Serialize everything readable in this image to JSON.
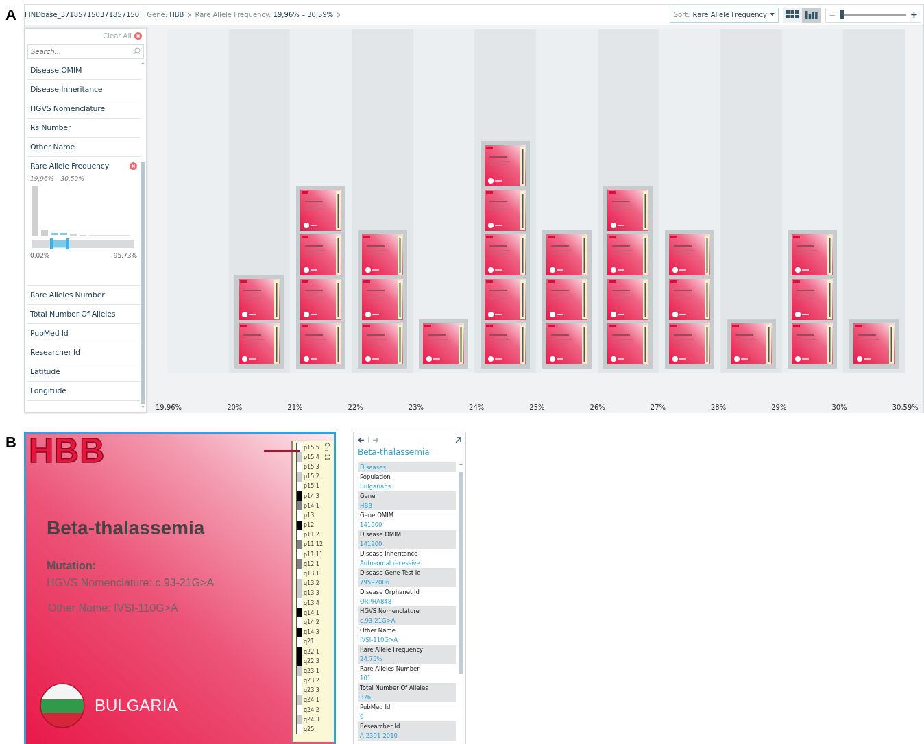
{
  "panel_labels": [
    "A",
    "B"
  ],
  "toolbar": {
    "collection": "FINDbase_371857150371857150",
    "breadcrumbs": [
      {
        "label": "Gene:",
        "value": "HBB"
      },
      {
        "label": "Rare Allele Frequency:",
        "value": "19,96% – 30,59%"
      }
    ],
    "sort": {
      "label": "Sort:",
      "value": "Rare Allele Frequency"
    },
    "views": [
      {
        "kind": "grid",
        "selected": false
      },
      {
        "kind": "bars",
        "selected": true
      }
    ],
    "zoom": {
      "minus": "−",
      "plus": "+",
      "level": 0.03
    }
  },
  "sidebar": {
    "clear_all": "Clear All",
    "search": {
      "placeholder": "Search..."
    },
    "facets": [
      {
        "label": "Disease OMIM",
        "expanded": false,
        "filtered": false
      },
      {
        "label": "Disease Inheritance",
        "expanded": false,
        "filtered": false
      },
      {
        "label": "HGVS Nomenclature",
        "expanded": false,
        "filtered": false
      },
      {
        "label": "Rs Number",
        "expanded": false,
        "filtered": false
      },
      {
        "label": "Other Name",
        "expanded": false,
        "filtered": false
      },
      {
        "label": "Rare Allele Frequency",
        "expanded": true,
        "filtered": true,
        "range": "19,96% – 30,59%",
        "min": "0,02%",
        "max": "95,73%"
      },
      {
        "label": "Rare Alleles Number",
        "expanded": false,
        "filtered": false
      },
      {
        "label": "Total Number Of Alleles",
        "expanded": false,
        "filtered": false
      },
      {
        "label": "PubMed Id",
        "expanded": false,
        "filtered": false
      },
      {
        "label": "Researcher Id",
        "expanded": false,
        "filtered": false
      },
      {
        "label": "Latitude",
        "expanded": false,
        "filtered": false
      },
      {
        "label": "Longitude",
        "expanded": false,
        "filtered": false
      }
    ]
  },
  "bins": [
    {
      "kind": "empty"
    },
    {
      "kind": "stack",
      "cards": [
        {
          "kind": "thumbnail"
        },
        {
          "kind": "thumbnail"
        }
      ]
    },
    {
      "kind": "stack",
      "cards": [
        {
          "kind": "thumbnail"
        },
        {
          "kind": "thumbnail"
        },
        {
          "kind": "thumbnail"
        },
        {
          "kind": "thumbnail"
        }
      ]
    },
    {
      "kind": "stack",
      "cards": [
        {
          "kind": "thumbnail"
        },
        {
          "kind": "thumbnail"
        },
        {
          "kind": "thumbnail"
        }
      ]
    },
    {
      "kind": "stack",
      "cards": [
        {
          "kind": "thumbnail"
        }
      ]
    },
    {
      "kind": "stack",
      "cards": [
        {
          "kind": "thumbnail"
        },
        {
          "kind": "thumbnail"
        },
        {
          "kind": "thumbnail"
        },
        {
          "kind": "thumbnail"
        },
        {
          "kind": "thumbnail"
        }
      ]
    },
    {
      "kind": "stack",
      "cards": [
        {
          "kind": "thumbnail"
        },
        {
          "kind": "thumbnail"
        },
        {
          "kind": "thumbnail"
        }
      ]
    },
    {
      "kind": "stack",
      "cards": [
        {
          "kind": "thumbnail"
        },
        {
          "kind": "thumbnail"
        },
        {
          "kind": "thumbnail"
        },
        {
          "kind": "thumbnail"
        }
      ]
    },
    {
      "kind": "stack",
      "cards": [
        {
          "kind": "thumbnail"
        },
        {
          "kind": "thumbnail"
        },
        {
          "kind": "thumbnail"
        }
      ]
    },
    {
      "kind": "stack",
      "cards": [
        {
          "kind": "thumbnail"
        }
      ]
    },
    {
      "kind": "stack",
      "cards": [
        {
          "kind": "thumbnail"
        },
        {
          "kind": "thumbnail"
        },
        {
          "kind": "thumbnail"
        }
      ]
    },
    {
      "kind": "stack",
      "cards": [
        {
          "kind": "thumbnail"
        }
      ]
    }
  ],
  "axis_labels": [
    "19,96%",
    "20%",
    "21%",
    "22%",
    "23%",
    "24%",
    "25%",
    "26%",
    "27%",
    "28%",
    "29%",
    "30%",
    "30,59%"
  ],
  "card": {
    "gene": "HBB",
    "title": "Beta-thalassemia",
    "mutation": "Mutation:",
    "hgvs": "HGVS Nomenclature: c.93-21G>A",
    "other_name": "Other Name: IVSI-110G>A",
    "country": "BULGARIA",
    "chromosome": "Chr 11",
    "bands": [
      {
        "label": "p15.5",
        "color": "#ffffff"
      },
      {
        "label": "p15.4",
        "color": "#c8c8c8"
      },
      {
        "label": "p15.3",
        "color": "#ffffff"
      },
      {
        "label": "p15.2",
        "color": "#c8c8c8"
      },
      {
        "label": "p15.1",
        "color": "#ffffff"
      },
      {
        "label": "p14.3",
        "color": "#000000"
      },
      {
        "label": "p14.1",
        "color": "#808080"
      },
      {
        "label": "p13",
        "color": "#ffffff"
      },
      {
        "label": "p12",
        "color": "#000000"
      },
      {
        "label": "p11.2",
        "color": "#ffffff"
      },
      {
        "label": "p11.12",
        "color": "#808080"
      },
      {
        "label": "p11.11",
        "color": "#ffffff"
      },
      {
        "label": "q12.1",
        "color": "#808080"
      },
      {
        "label": "q13.1",
        "color": "#ffffff"
      },
      {
        "label": "q13.2",
        "color": "#c8c8c8"
      },
      {
        "label": "q13.3",
        "color": "#c8c8c8"
      },
      {
        "label": "q13.4",
        "color": "#ffffff"
      },
      {
        "label": "q14.1",
        "color": "#000000"
      },
      {
        "label": "q14.2",
        "color": "#ffffff"
      },
      {
        "label": "q14.3",
        "color": "#000000"
      },
      {
        "label": "q21",
        "color": "#ffffff"
      },
      {
        "label": "q22.1",
        "color": "#000000"
      },
      {
        "label": "q22.3",
        "color": "#000000"
      },
      {
        "label": "q23.1",
        "color": "#c8c8c8"
      },
      {
        "label": "q23.2",
        "color": "#ffffff"
      },
      {
        "label": "q23.3",
        "color": "#ffffff"
      },
      {
        "label": "q24.1",
        "color": "#c8c8c8"
      },
      {
        "label": "q24.2",
        "color": "#ffffff"
      },
      {
        "label": "q24.3",
        "color": "#c8c8c8"
      },
      {
        "label": "q25",
        "color": "#ffffff"
      }
    ]
  },
  "details": {
    "title": "Beta-thalassemia",
    "rows": [
      {
        "value": "Diseases"
      },
      {
        "label": "Population",
        "value": "Bulgarians"
      },
      {
        "label": "Gene",
        "value": "HBB"
      },
      {
        "label": "Gene OMIM",
        "value": "141900"
      },
      {
        "label": "Disease OMIM",
        "value": "141900"
      },
      {
        "label": "Disease Inheritance",
        "value": "Autosomal recessive"
      },
      {
        "label": "Disease Gene Test Id",
        "value": "79592006"
      },
      {
        "label": "Disease Orphanet Id",
        "value": "ORPHA848"
      },
      {
        "label": "HGVS Nomenclature",
        "value": "c.93-21G>A"
      },
      {
        "label": "Other Name",
        "value": "IVSI-110G>A"
      },
      {
        "label": "Rare Allele Frequency",
        "value": "24.75%"
      },
      {
        "label": "Rare Alleles Number",
        "value": "101"
      },
      {
        "label": "Total Number Of Alleles",
        "value": "376"
      },
      {
        "label": "PubMed Id",
        "value": "0"
      },
      {
        "label": "Researcher Id",
        "value": "A-2391-2010"
      }
    ]
  }
}
